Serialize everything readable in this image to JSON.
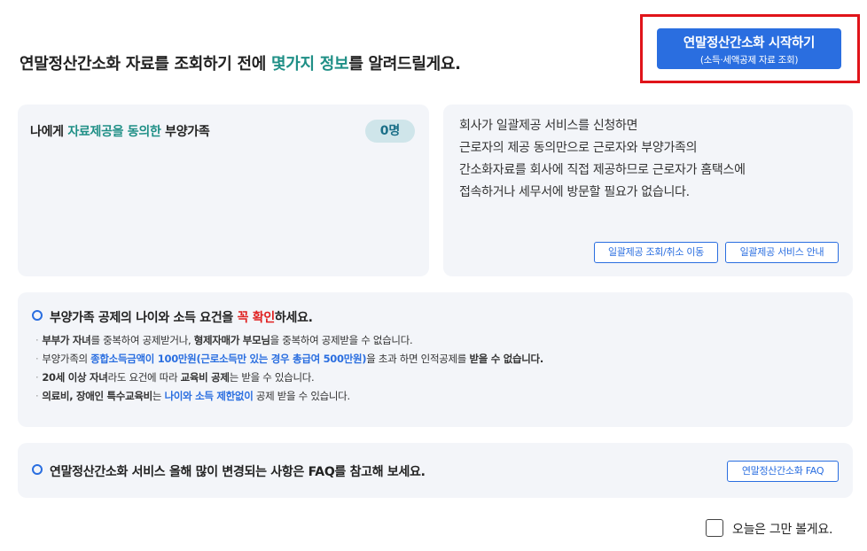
{
  "headline": {
    "before": "연말정산간소화 자료를 조회하기 전에 ",
    "highlight": "몇가지 정보",
    "after": "를 알려드릴게요."
  },
  "start_button": {
    "main": "연말정산간소화 시작하기",
    "sub": "(소득·세액공제 자료 조회)"
  },
  "dependents": {
    "prefix": "나에게 ",
    "highlight": "자료제공을 동의한",
    "suffix": " 부양가족",
    "count": "0명"
  },
  "bulk_info": {
    "lines": [
      "회사가 일괄제공 서비스를 신청하면",
      "근로자의 제공 동의만으로 근로자와 부양가족의",
      "간소화자료를 회사에 직접 제공하므로 근로자가 홈택스에",
      "접속하거나 세무서에 방문할 필요가 없습니다."
    ],
    "btn_query": "일괄제공 조회/취소 이동",
    "btn_guide": "일괄제공 서비스 안내"
  },
  "notice": {
    "title_a": "부양가족 공제의 나이와 소득 요건을 ",
    "title_red1": "꼭",
    "title_space": " ",
    "title_red2": "확인",
    "title_b": "하세요.",
    "b1": {
      "p1": "부부가 자녀",
      "p2": "를 중복하여 공제받거나, ",
      "p3": "형제자매가 부모님",
      "p4": "을 중복하여 공제받을 수 없습니다."
    },
    "b2": {
      "p1": "부양가족의 ",
      "p2": "종합소득금액이 100만원(근로소득만 있는 경우 총급여 500만원)",
      "p3": "을 초과 하면 인적공제를 ",
      "p4": "받을 수 없습니다."
    },
    "b3": {
      "p1": "20세 이상 자녀",
      "p2": "라도 요건에 따라 ",
      "p3": "교육비 공제",
      "p4": "는 받을 수 있습니다."
    },
    "b4": {
      "p1": "의료비, 장애인 특수교육비",
      "p2": "는 ",
      "p3": "나이와 소득 제한없이",
      "p4": " 공제 받을 수 있습니다."
    }
  },
  "faq": {
    "title": "연말정산간소화 서비스 올해 많이 변경되는 사항은 FAQ를 참고해 보세요.",
    "button": "연말정산간소화 FAQ"
  },
  "dismiss": {
    "label": "오늘은 그만 볼게요."
  }
}
